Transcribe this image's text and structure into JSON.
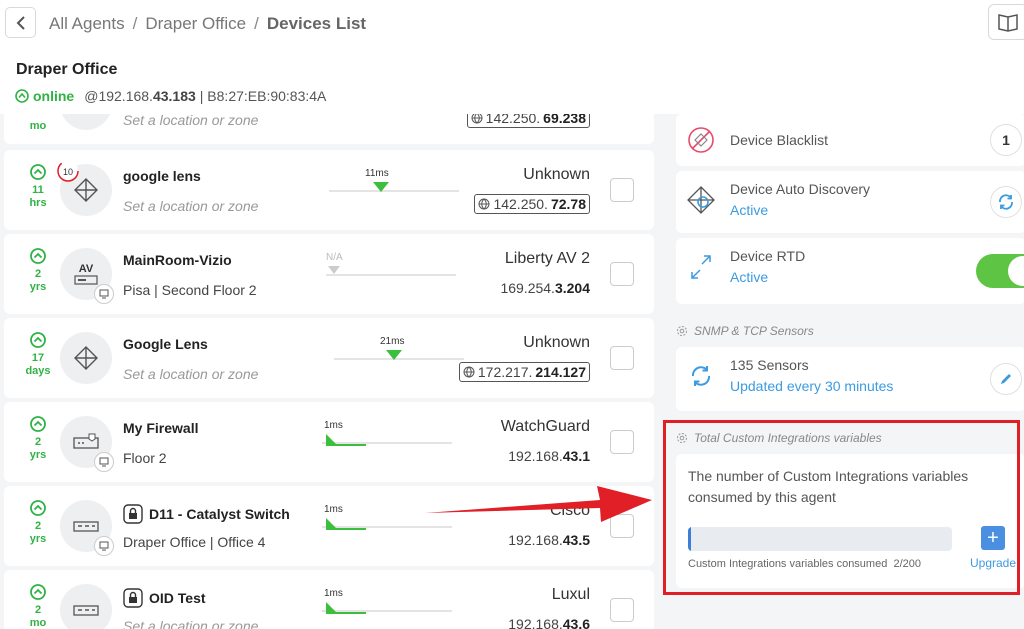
{
  "header": {
    "breadcrumb": [
      "All Agents",
      "Draper Office",
      "Devices List"
    ],
    "separator": "/",
    "agent_name": "Draper Office",
    "status": "online",
    "ip_prefix": "@192.168.",
    "ip_bold": "43.183",
    "mac": "| B8:27:EB:90:83:4A"
  },
  "devices": [
    {
      "uptime_num": "",
      "uptime_unit": "mo",
      "name": "",
      "location": "Set a location or zone",
      "vendor": "",
      "ip_prefix": "142.250.",
      "ip_bold": "69.238"
    },
    {
      "uptime_num": "11",
      "uptime_unit": "hrs",
      "name": "google lens",
      "badge_count": "10",
      "location": "Set a location or zone",
      "latency": "11ms",
      "vendor": "Unknown",
      "ip_prefix": "142.250.",
      "ip_bold": "72.78"
    },
    {
      "uptime_num": "2",
      "uptime_unit": "yrs",
      "name": "MainRoom-Vizio",
      "location": "Pisa | Second Floor 2",
      "latency": "N/A",
      "vendor": "Liberty AV 2",
      "ip_prefix": "169.254.",
      "ip_bold": "3.204",
      "avatar_text": "AV"
    },
    {
      "uptime_num": "17",
      "uptime_unit": "days",
      "name": "Google Lens",
      "location": "Set a location or zone",
      "latency": "21ms",
      "vendor": "Unknown",
      "ip_prefix": "172.217.",
      "ip_bold": "214.127"
    },
    {
      "uptime_num": "2",
      "uptime_unit": "yrs",
      "name": "My Firewall",
      "location": "Floor 2",
      "latency": "1ms",
      "vendor": "WatchGuard",
      "ip_prefix": "192.168.",
      "ip_bold": "43.1"
    },
    {
      "uptime_num": "2",
      "uptime_unit": "yrs",
      "name": "D11 - Catalyst Switch",
      "location": "Draper Office | Office 4",
      "latency": "1ms",
      "vendor": "Cisco",
      "ip_prefix": "192.168.",
      "ip_bold": "43.5"
    },
    {
      "uptime_num": "2",
      "uptime_unit": "mo",
      "name": "OID Test",
      "location": "Set a location or zone",
      "latency": "1ms",
      "vendor": "Luxul",
      "ip_prefix": "192.168.",
      "ip_bold": "43.6"
    }
  ],
  "panel": {
    "blacklist": {
      "title": "Device Blacklist",
      "count": "1"
    },
    "auto_discovery": {
      "title": "Device Auto Discovery",
      "status": "Active"
    },
    "rtd": {
      "title": "Device RTD",
      "status": "Active",
      "enabled": true
    },
    "snmp_section": "SNMP & TCP Sensors",
    "sensors": {
      "title": "135 Sensors",
      "subtitle": "Updated every 30 minutes"
    },
    "ci_section": "Total Custom Integrations variables",
    "ci": {
      "description": "The number of Custom Integrations variables consumed by this agent",
      "consumed_label": "Custom Integrations variables consumed",
      "consumed_value": "2/200",
      "consumed_fraction": 0.01,
      "upgrade_label": "Upgrade"
    }
  },
  "colors": {
    "online": "#2fb344",
    "accent": "#3b9be0",
    "highlight": "#e01f26",
    "toggle": "#5ec443"
  }
}
